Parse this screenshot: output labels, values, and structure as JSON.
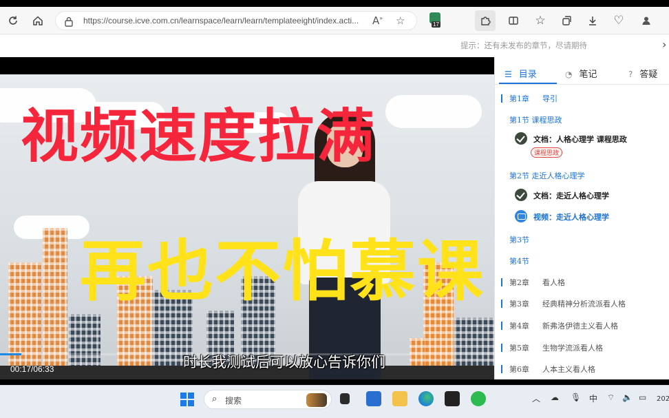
{
  "browser": {
    "url": "https://course.icve.com.cn/learnspace/learn/learn/templateeight/index.acti...",
    "extension_badge": "17"
  },
  "page": {
    "hint": "提示：还有未发布的章节，尽请期待"
  },
  "video": {
    "overlay_title_red": "视频速度拉满",
    "overlay_title_yellow": "再也不怕慕课",
    "subtitle": "时长我测试后可以放心告诉你们",
    "time": "00:17/06:33",
    "progress": 0.043
  },
  "panel": {
    "tabs": [
      {
        "label": "目录",
        "icon": "list-icon",
        "active": true
      },
      {
        "label": "笔记",
        "icon": "note-icon",
        "active": false
      },
      {
        "label": "答疑",
        "icon": "question-icon",
        "active": false
      }
    ],
    "toc": {
      "ch1": {
        "num": "第1章",
        "name": "导引"
      },
      "s1": {
        "label": "第1节  课程思政"
      },
      "r1": {
        "text": "文档：人格心理学 课程思政",
        "tag": "课程思政"
      },
      "s2": {
        "label": "第2节  走近人格心理学"
      },
      "r2": {
        "text": "文档：走近人格心理学"
      },
      "r3": {
        "text": "视频：走近人格心理学"
      },
      "s3": {
        "label": "第3节"
      },
      "s4": {
        "label": "第4节"
      },
      "ch2": {
        "num": "第2章",
        "name": "看人格"
      },
      "ch3": {
        "num": "第3章",
        "name": "经典精神分析流派看人格"
      },
      "ch4": {
        "num": "第4章",
        "name": "新弗洛伊德主义看人格"
      },
      "ch5": {
        "num": "第5章",
        "name": "生物学流派看人格"
      },
      "ch6": {
        "num": "第6章",
        "name": "人本主义看人格"
      }
    }
  },
  "taskbar": {
    "search_placeholder": "搜索",
    "ime": "中",
    "clock": "202"
  },
  "colors": {
    "accent": "#1b73d8",
    "title_red": "#f5263c",
    "title_yellow": "#ffe21a"
  }
}
